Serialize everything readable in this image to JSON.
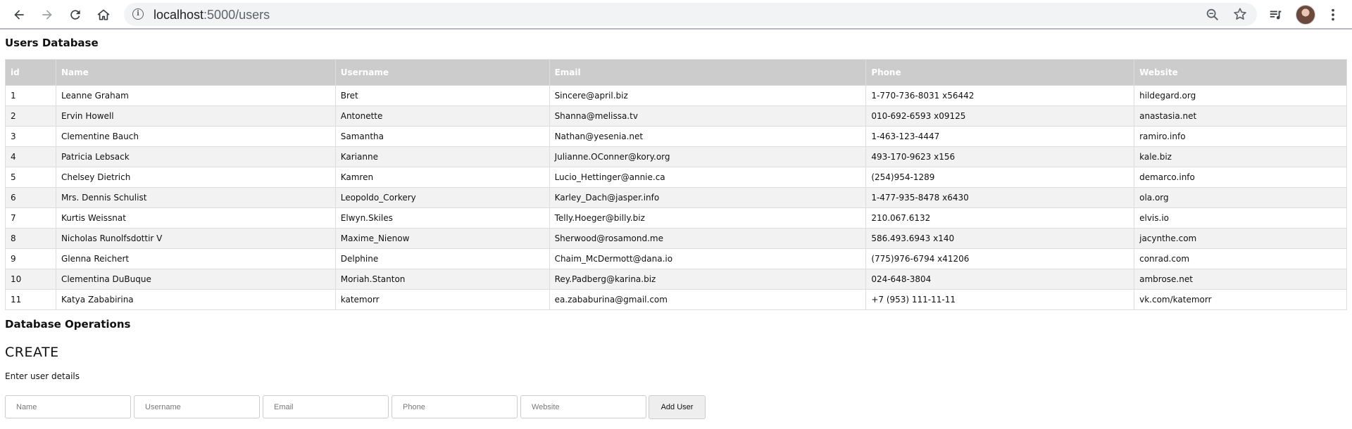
{
  "browser": {
    "url_host": "localhost",
    "url_path": ":5000/users"
  },
  "page": {
    "title": "Users Database",
    "table": {
      "headers": [
        "id",
        "Name",
        "Username",
        "Email",
        "Phone",
        "Website"
      ],
      "rows": [
        [
          "1",
          "Leanne Graham",
          "Bret",
          "Sincere@april.biz",
          "1-770-736-8031 x56442",
          "hildegard.org"
        ],
        [
          "2",
          "Ervin Howell",
          "Antonette",
          "Shanna@melissa.tv",
          "010-692-6593 x09125",
          "anastasia.net"
        ],
        [
          "3",
          "Clementine Bauch",
          "Samantha",
          "Nathan@yesenia.net",
          "1-463-123-4447",
          "ramiro.info"
        ],
        [
          "4",
          "Patricia Lebsack",
          "Karianne",
          "Julianne.OConner@kory.org",
          "493-170-9623 x156",
          "kale.biz"
        ],
        [
          "5",
          "Chelsey Dietrich",
          "Kamren",
          "Lucio_Hettinger@annie.ca",
          "(254)954-1289",
          "demarco.info"
        ],
        [
          "6",
          "Mrs. Dennis Schulist",
          "Leopoldo_Corkery",
          "Karley_Dach@jasper.info",
          "1-477-935-8478 x6430",
          "ola.org"
        ],
        [
          "7",
          "Kurtis Weissnat",
          "Elwyn.Skiles",
          "Telly.Hoeger@billy.biz",
          "210.067.6132",
          "elvis.io"
        ],
        [
          "8",
          "Nicholas Runolfsdottir V",
          "Maxime_Nienow",
          "Sherwood@rosamond.me",
          "586.493.6943 x140",
          "jacynthe.com"
        ],
        [
          "9",
          "Glenna Reichert",
          "Delphine",
          "Chaim_McDermott@dana.io",
          "(775)976-6794 x41206",
          "conrad.com"
        ],
        [
          "10",
          "Clementina DuBuque",
          "Moriah.Stanton",
          "Rey.Padberg@karina.biz",
          "024-648-3804",
          "ambrose.net"
        ],
        [
          "11",
          "Katya Zababirina",
          "katemorr",
          "ea.zababurina@gmail.com",
          "+7 (953) 111-11-11",
          "vk.com/katemorr"
        ]
      ]
    },
    "operations_title": "Database Operations",
    "create": {
      "title": "CREATE",
      "hint": "Enter user details",
      "placeholders": {
        "name": "Name",
        "username": "Username",
        "email": "Email",
        "phone": "Phone",
        "website": "Website"
      },
      "button_label": "Add User"
    }
  }
}
